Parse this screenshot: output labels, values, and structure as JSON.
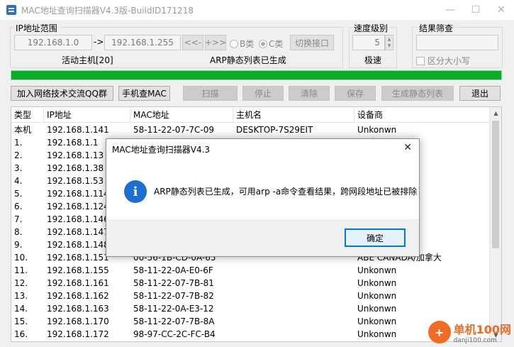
{
  "window": {
    "title": "MAC地址查询扫描器V4.3版-BuildID171218",
    "controls": {
      "minimize": "—",
      "maximize": "☐",
      "close": "✕"
    }
  },
  "ip_range": {
    "label": "IP地址范围",
    "start": "192.168.1.0",
    "arrow": "->",
    "end": "192.168.1.255",
    "prev_label": "<<-",
    "next_label": "+>>",
    "radio_b": "B类",
    "radio_c": "C类",
    "switch_label": "切换接口",
    "active_hosts": "活动主机[20]",
    "arp_status": "ARP静态列表已生成"
  },
  "speed": {
    "label": "速度级别",
    "value": "5",
    "up": "▲",
    "down": "▼",
    "mode": "极速"
  },
  "filter": {
    "label": "结果筛查",
    "value": "",
    "case_label": "区分大小写"
  },
  "progress": {
    "percent": 100,
    "color": "#06b025"
  },
  "toolbar": {
    "qq_group": "加入网络技术交流QQ群",
    "manual_lookup": "手机查MAC",
    "scan": "扫描",
    "stop": "停止",
    "clear": "清除",
    "save": "保存",
    "gen_static": "生成静态列表",
    "exit": "退出"
  },
  "table": {
    "headers": [
      "类型",
      "IP地址",
      "MAC地址",
      "主机名",
      "设备商"
    ],
    "rows": [
      [
        "本机",
        "192.168.1.141",
        "58-11-22-07-7C-09",
        "DESKTOP-7S29EIT",
        "Unkonwn"
      ],
      [
        "1.",
        "192.168.1.1",
        "",
        "",
        "X)/中国"
      ],
      [
        "2.",
        "192.168.1.13",
        "",
        "",
        "拿大"
      ],
      [
        "3.",
        "192.168.1.38",
        "",
        "",
        ""
      ],
      [
        "4.",
        "192.168.1.53",
        "",
        "",
        ""
      ],
      [
        "5.",
        "192.168.1.114",
        "",
        "",
        ""
      ],
      [
        "6.",
        "192.168.1.124",
        "",
        "",
        ""
      ],
      [
        "7.",
        "192.168.1.146",
        "",
        "",
        ""
      ],
      [
        "8.",
        "192.168.1.147",
        "",
        "",
        "ranch H.K...."
      ],
      [
        "9.",
        "192.168.1.148",
        "",
        "",
        ""
      ],
      [
        "10.",
        "192.168.1.151",
        "00-56-1B-CD-0A-65",
        "",
        "ABE CANADA/加拿大"
      ],
      [
        "11.",
        "192.168.1.155",
        "58-11-22-0A-E0-6F",
        "",
        "Unkonwn"
      ],
      [
        "12.",
        "192.168.1.161",
        "58-11-22-07-7B-81",
        "",
        "Unkonwn"
      ],
      [
        "13.",
        "192.168.1.162",
        "58-11-22-07-7B-82",
        "",
        "Unkonwn"
      ],
      [
        "14.",
        "192.168.1.163",
        "58-11-22-0A-E3-12",
        "",
        "Unkonwn"
      ],
      [
        "15.",
        "192.168.1.170",
        "58-11-22-07-7B-8A",
        "",
        "Unkonwn"
      ],
      [
        "16.",
        "192.168.1.172",
        "98-97-CC-2C-FC-B4",
        "",
        "Unkonwn"
      ]
    ]
  },
  "dialog": {
    "title": "MAC地址查询扫描器V4.3",
    "close": "✕",
    "icon": "i",
    "message": "ARP静态列表已生成，可用arp -a命令查看结果，跨网段地址已被排除",
    "ok": "确定"
  },
  "watermark": {
    "badge": "+",
    "main": "单机100网",
    "sub": "danji100.com"
  }
}
